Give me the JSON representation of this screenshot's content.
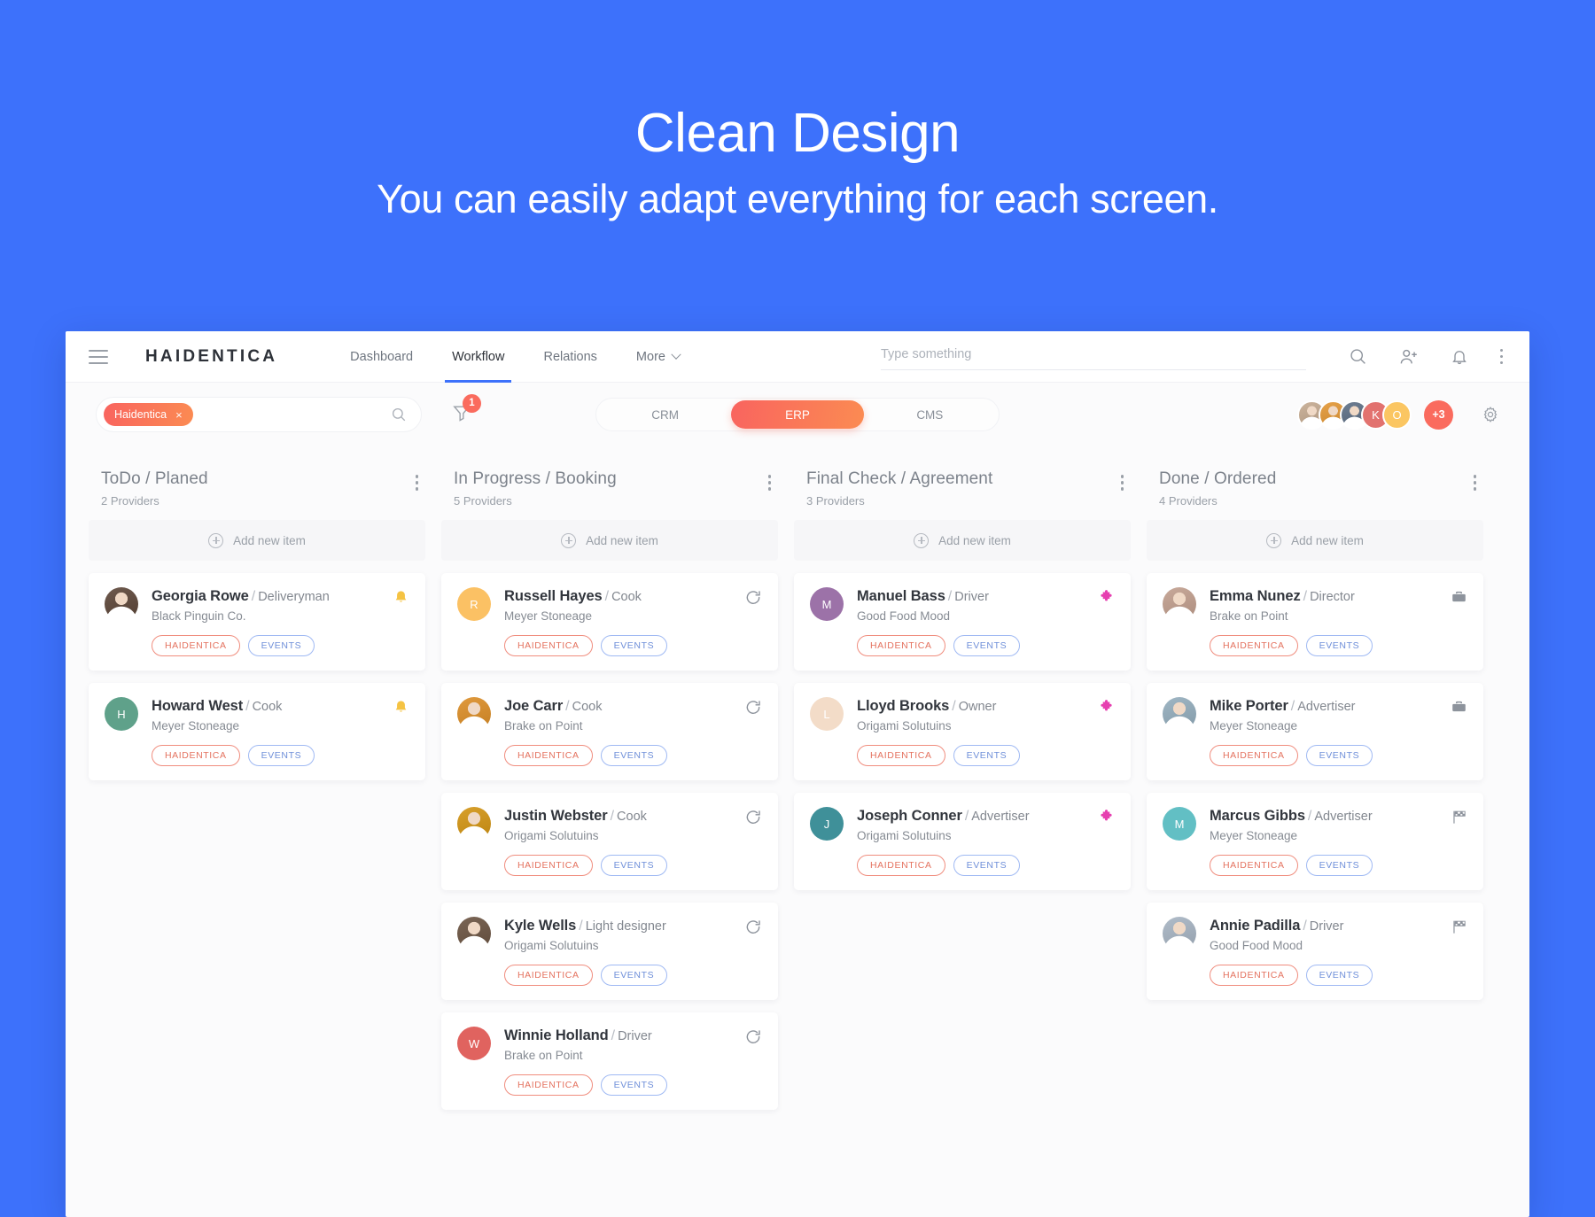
{
  "hero": {
    "title": "Clean Design",
    "subtitle": "You can easily adapt everything for each screen."
  },
  "topbar": {
    "brand": "HAIDENTICA",
    "nav": [
      {
        "label": "Dashboard",
        "active": false
      },
      {
        "label": "Workflow",
        "active": true
      },
      {
        "label": "Relations",
        "active": false
      },
      {
        "label": "More",
        "active": false,
        "caret": true
      }
    ],
    "search_placeholder": "Type something",
    "search_value": "",
    "icons": [
      "search-icon",
      "add-person-icon",
      "bell-icon",
      "more-vertical-icon"
    ]
  },
  "toolbar": {
    "filter_chip": "Haidentica",
    "filter_chip_close": "×",
    "filter_badge": "1",
    "segments": [
      {
        "label": "CRM",
        "active": false
      },
      {
        "label": "ERP",
        "active": true
      },
      {
        "label": "CMS",
        "active": false
      }
    ],
    "avatars": [
      {
        "type": "photo",
        "tone": "#cbb39c"
      },
      {
        "type": "photo",
        "tone": "#e6a24a"
      },
      {
        "type": "photo",
        "tone": "#6e7e92"
      },
      {
        "type": "initial",
        "label": "K",
        "color": "#e2726f"
      },
      {
        "type": "initial",
        "label": "O",
        "color": "#fbc662"
      }
    ],
    "overflow_label": "+3",
    "gear": "gear-icon"
  },
  "colors": {
    "accent_start": "#f9645f",
    "accent_end": "#fb8b52",
    "brand_blue": "#3d71fb",
    "tag_red": "#e4725f",
    "tag_blue": "#6f8fd9"
  },
  "add_new_label": "Add new item",
  "columns": [
    {
      "title": "ToDo / Planed",
      "count": "2 Providers",
      "card_icon": "bell-icon",
      "card_icon_color": "#f5c343",
      "cards": [
        {
          "name": "Georgia Rowe",
          "sep": "/",
          "role": "Deliveryman",
          "company": "Black Pinguin Co.",
          "avatar_type": "photo",
          "avatar_initial": "",
          "avatar_color": "#6e5a4e",
          "tags": [
            "HAIDENTICA",
            "EVENTS"
          ]
        },
        {
          "name": "Howard West",
          "sep": "/",
          "role": "Cook",
          "company": "Meyer Stoneage",
          "avatar_type": "initial",
          "avatar_initial": "H",
          "avatar_color": "#5fa18a",
          "tags": [
            "HAIDENTICA",
            "EVENTS"
          ]
        }
      ]
    },
    {
      "title": "In Progress / Booking",
      "count": "5 Providers",
      "card_icon": "refresh-icon",
      "card_icon_color": "#8d939c",
      "cards": [
        {
          "name": "Russell Hayes",
          "sep": "/",
          "role": "Cook",
          "company": "Meyer Stoneage",
          "avatar_type": "initial",
          "avatar_initial": "R",
          "avatar_color": "#fbc164",
          "tags": [
            "HAIDENTICA",
            "EVENTS"
          ]
        },
        {
          "name": "Joe Carr",
          "sep": "/",
          "role": "Cook",
          "company": "Brake on Point",
          "avatar_type": "photo",
          "avatar_initial": "",
          "avatar_color": "#e09a3e",
          "tags": [
            "HAIDENTICA",
            "EVENTS"
          ]
        },
        {
          "name": "Justin Webster",
          "sep": "/",
          "role": "Cook",
          "company": "Origami Solutuins",
          "avatar_type": "photo",
          "avatar_initial": "",
          "avatar_color": "#d8a02c",
          "tags": [
            "HAIDENTICA",
            "EVENTS"
          ]
        },
        {
          "name": "Kyle Wells",
          "sep": "/",
          "role": "Light designer",
          "company": "Origami Solutuins",
          "avatar_type": "photo",
          "avatar_initial": "",
          "avatar_color": "#7b6656",
          "tags": [
            "HAIDENTICA",
            "EVENTS"
          ]
        },
        {
          "name": "Winnie Holland",
          "sep": "/",
          "role": "Driver",
          "company": "Brake on Point",
          "avatar_type": "initial",
          "avatar_initial": "W",
          "avatar_color": "#e0635f",
          "tags": [
            "HAIDENTICA",
            "EVENTS"
          ]
        }
      ]
    },
    {
      "title": "Final Check / Agreement",
      "count": "3 Providers",
      "card_icon": "puzzle-icon",
      "card_icon_color": "#e63fb0",
      "cards": [
        {
          "name": "Manuel Bass",
          "sep": "/",
          "role": "Driver",
          "company": "Good Food Mood",
          "avatar_type": "initial",
          "avatar_initial": "M",
          "avatar_color": "#9c72a8",
          "tags": [
            "HAIDENTICA",
            "EVENTS"
          ]
        },
        {
          "name": "Lloyd Brooks",
          "sep": "/",
          "role": "Owner",
          "company": "Origami Solutuins",
          "avatar_type": "initial",
          "avatar_initial": "L",
          "avatar_color": "#f3dcc8",
          "tags": [
            "HAIDENTICA",
            "EVENTS"
          ]
        },
        {
          "name": "Joseph Conner",
          "sep": "/",
          "role": "Advertiser",
          "company": "Origami Solutuins",
          "avatar_type": "initial",
          "avatar_initial": "J",
          "avatar_color": "#3f9099",
          "tags": [
            "HAIDENTICA",
            "EVENTS"
          ]
        }
      ]
    },
    {
      "title": "Done / Ordered",
      "count": "4 Providers",
      "card_icon": "briefcase-icon",
      "card_icon_color": "#8d939c",
      "cards": [
        {
          "name": "Emma Nunez",
          "sep": "/",
          "role": "Director",
          "company": "Brake on Point",
          "avatar_type": "photo",
          "avatar_initial": "",
          "avatar_color": "#c8a99a",
          "icon": "briefcase-icon",
          "tags": [
            "HAIDENTICA",
            "EVENTS"
          ]
        },
        {
          "name": "Mike Porter",
          "sep": "/",
          "role": "Advertiser",
          "company": "Meyer Stoneage",
          "avatar_type": "photo",
          "avatar_initial": "",
          "avatar_color": "#9fb6c4",
          "icon": "briefcase-icon",
          "tags": [
            "HAIDENTICA",
            "EVENTS"
          ]
        },
        {
          "name": "Marcus Gibbs",
          "sep": "/",
          "role": "Advertiser",
          "company": "Meyer Stoneage",
          "avatar_type": "initial",
          "avatar_initial": "M",
          "avatar_color": "#62bfc4",
          "icon": "flag-icon",
          "tags": [
            "HAIDENTICA",
            "EVENTS"
          ]
        },
        {
          "name": "Annie Padilla",
          "sep": "/",
          "role": "Driver",
          "company": "Good Food Mood",
          "avatar_type": "photo",
          "avatar_initial": "",
          "avatar_color": "#b0bcc9",
          "icon": "flag-icon",
          "tags": [
            "HAIDENTICA",
            "EVENTS"
          ]
        }
      ]
    }
  ]
}
